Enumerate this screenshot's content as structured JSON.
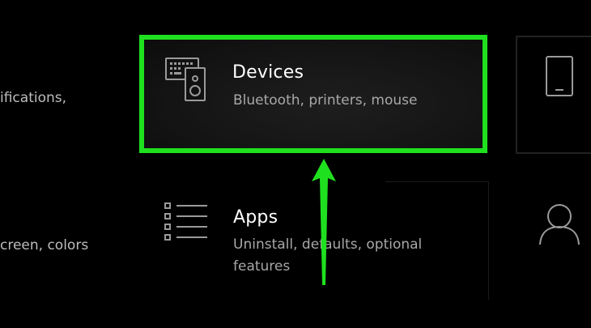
{
  "left_column": {
    "item1_desc": "ifications,",
    "item2_desc": "creen, colors"
  },
  "tiles": {
    "devices": {
      "title": "Devices",
      "subtitle": "Bluetooth, printers, mouse",
      "icon": "keyboard-speaker-icon"
    },
    "apps": {
      "title": "Apps",
      "subtitle": "Uninstall, defaults, optional features",
      "icon": "list-icon"
    }
  },
  "right_column": {
    "phone_icon": "phone-icon",
    "person_icon": "person-icon"
  },
  "annotation": {
    "highlight_color": "#1fe01f",
    "arrow_icon": "up-arrow-icon"
  }
}
